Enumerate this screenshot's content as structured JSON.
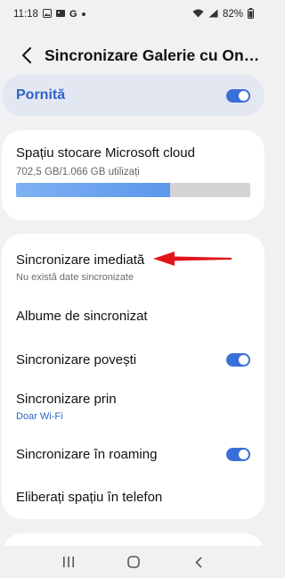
{
  "status_bar": {
    "time": "11:18",
    "left_icons": [
      "gallery-icon",
      "photos-icon",
      "google-icon",
      "dot-icon"
    ],
    "battery": "82%"
  },
  "header": {
    "title": "Sincronizare Galerie cu OneDrive"
  },
  "master_switch": {
    "label": "Pornită",
    "enabled": true
  },
  "storage": {
    "title": "Spațiu stocare Microsoft cloud",
    "usage": "702,5 GB/1.066 GB utilizați",
    "used_fraction": 0.659
  },
  "settings": {
    "sync_now": {
      "label": "Sincronizare imediată",
      "sub": "Nu există date sincronizate"
    },
    "albums": {
      "label": "Albume de sincronizat"
    },
    "stories": {
      "label": "Sincronizare povești",
      "enabled": true
    },
    "sync_via": {
      "label": "Sincronizare prin",
      "sub": "Doar Wi-Fi"
    },
    "roaming": {
      "label": "Sincronizare în roaming",
      "enabled": true
    },
    "free_space": {
      "label": "Eliberați spațiu în telefon"
    }
  },
  "colors": {
    "accent": "#2d64c9",
    "toggle_on": "#3a6fd8",
    "annotation_arrow": "#e3141b"
  }
}
